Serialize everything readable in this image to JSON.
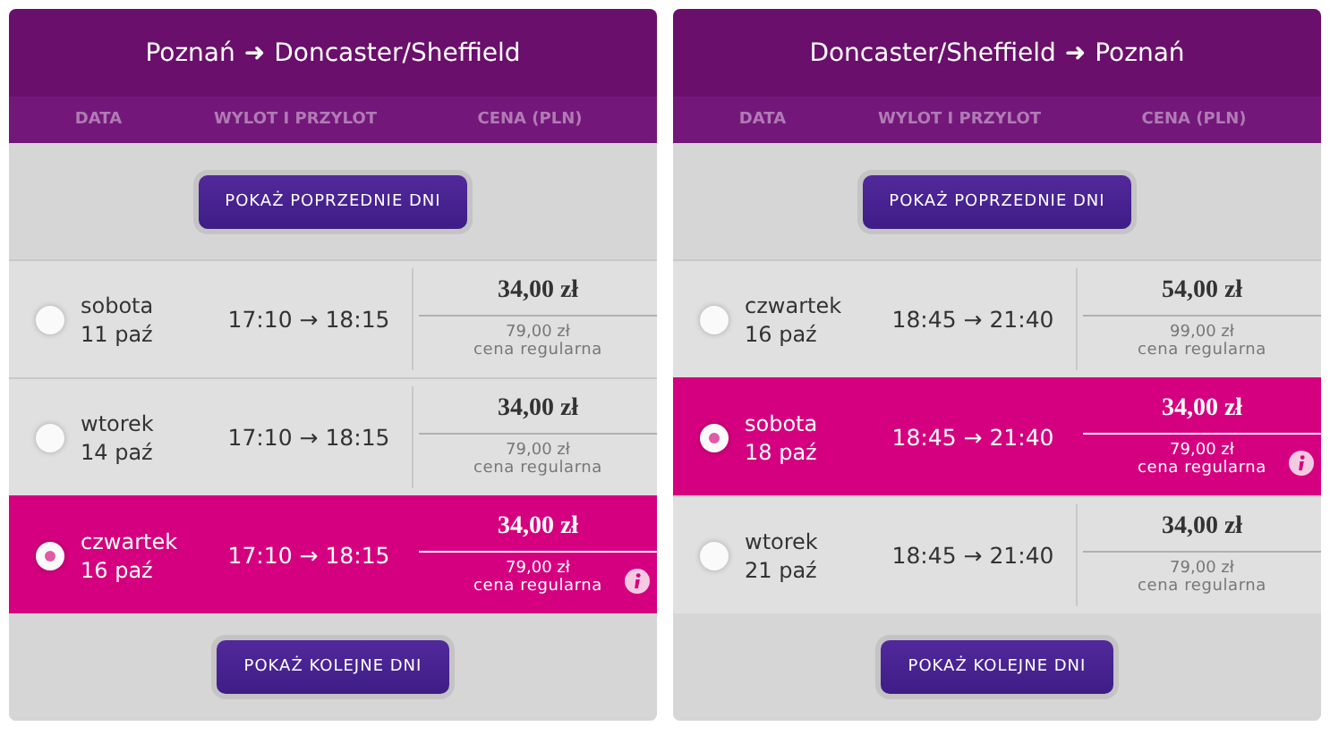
{
  "panels": [
    {
      "route": {
        "origin": "Poznań",
        "arrow": "➜",
        "destination": "Doncaster/Sheffield"
      },
      "columns": [
        "DATA",
        "WYLOT I PRZYLOT",
        "CENA (PLN)"
      ],
      "prev_button": "POKAŻ POPRZEDNIE DNI",
      "next_button": "POKAŻ KOLEJNE DNI",
      "flights": [
        {
          "day": "sobota",
          "date": "11 paź",
          "time": "17:10 → 18:15",
          "price": "34,00 zł",
          "regular_price": "79,00 zł",
          "regular_label": "cena regularna",
          "selected": false
        },
        {
          "day": "wtorek",
          "date": "14 paź",
          "time": "17:10 → 18:15",
          "price": "34,00 zł",
          "regular_price": "79,00 zł",
          "regular_label": "cena regularna",
          "selected": false
        },
        {
          "day": "czwartek",
          "date": "16 paź",
          "time": "17:10 → 18:15",
          "price": "34,00 zł",
          "regular_price": "79,00 zł",
          "regular_label": "cena regularna",
          "selected": true
        }
      ]
    },
    {
      "route": {
        "origin": "Doncaster/Sheffield",
        "arrow": "➜",
        "destination": "Poznań"
      },
      "columns": [
        "DATA",
        "WYLOT I PRZYLOT",
        "CENA (PLN)"
      ],
      "prev_button": "POKAŻ POPRZEDNIE DNI",
      "next_button": "POKAŻ KOLEJNE DNI",
      "flights": [
        {
          "day": "czwartek",
          "date": "16 paź",
          "time": "18:45 → 21:40",
          "price": "54,00 zł",
          "regular_price": "99,00 zł",
          "regular_label": "cena regularna",
          "selected": false
        },
        {
          "day": "sobota",
          "date": "18 paź",
          "time": "18:45 → 21:40",
          "price": "34,00 zł",
          "regular_price": "79,00 zł",
          "regular_label": "cena regularna",
          "selected": true
        },
        {
          "day": "wtorek",
          "date": "21 paź",
          "time": "18:45 → 21:40",
          "price": "34,00 zł",
          "regular_price": "79,00 zł",
          "regular_label": "cena regularna",
          "selected": false
        }
      ]
    }
  ]
}
